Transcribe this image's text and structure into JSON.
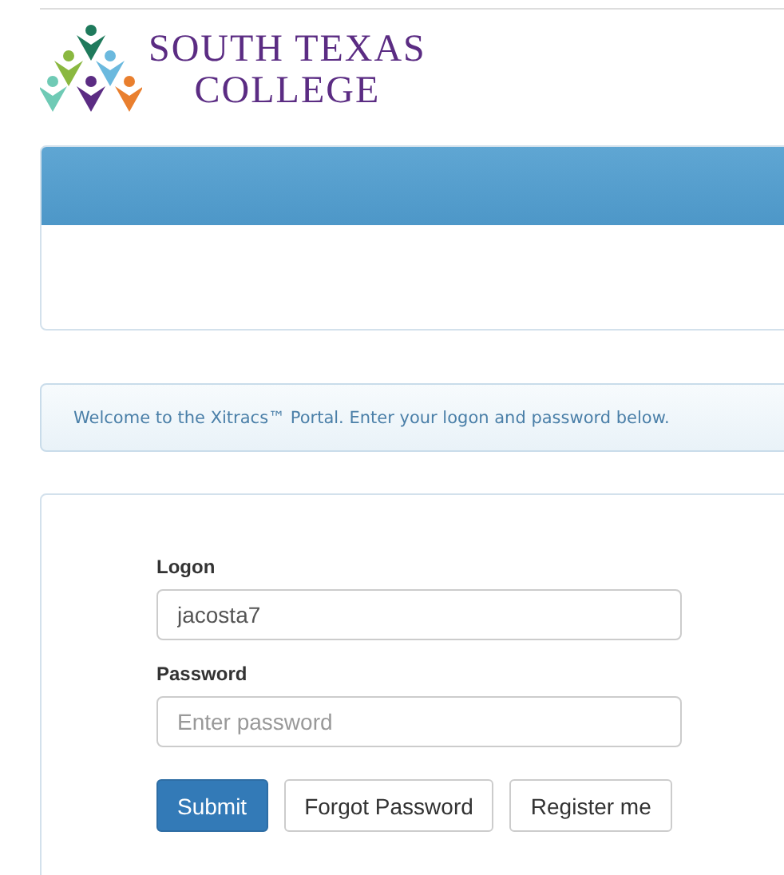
{
  "logo": {
    "lines": [
      "SOUTH TEXAS",
      "COLLEGE"
    ]
  },
  "notice": "Welcome to the Xitracs™ Portal. Enter your logon and password below.",
  "form": {
    "fields": [
      {
        "label": "Logon",
        "value": "jacosta7"
      },
      {
        "label": "Password",
        "placeholder": "Enter password"
      }
    ],
    "buttons": [
      {
        "label": "Submit",
        "kind": "primary"
      },
      {
        "label": "Forgot Password",
        "kind": "default"
      },
      {
        "label": "Register me",
        "kind": "default"
      }
    ]
  }
}
